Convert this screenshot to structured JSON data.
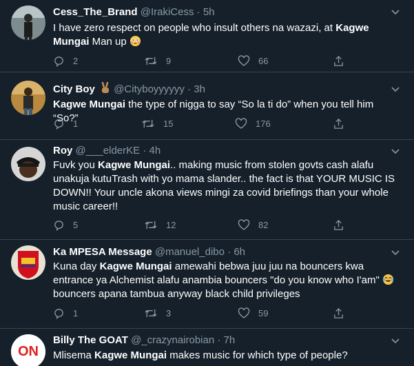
{
  "tweets": [
    {
      "name": "Cess_The_Brand",
      "handle": "@IrakiCess",
      "time": "5h",
      "body_before": "I have zero respect on people who insult others na wazazi, at ",
      "mention": "Kagwe Mungai",
      "body_after": " Man up",
      "emoji": "flushed-face",
      "replies": "2",
      "retweets": "9",
      "likes": "66"
    },
    {
      "name": "City Boy",
      "name_emoji": "victory-hand",
      "handle": "@Cityboyyyyyy",
      "time": "3h",
      "mention": "Kagwe Mungai",
      "body_after": " the type of nigga to say “So la ti do” when you tell him “So?”",
      "replies": "1",
      "retweets": "15",
      "likes": "176"
    },
    {
      "name": "Roy",
      "handle": "@___elderKE",
      "time": "4h",
      "body_before": "Fuvk you ",
      "mention": "Kagwe Mungai",
      "body_after": ".. making music from stolen govts cash alafu unakuja kutuTrash with yo mama slander.. the fact is that YOUR MUSIC IS DOWN!! Your uncle akona views mingi za covid briefings than your whole music career!!",
      "replies": "5",
      "retweets": "12",
      "likes": "82"
    },
    {
      "name": "Ka MPESA Message",
      "handle": "@manuel_dibo",
      "time": "6h",
      "body_before": "Kuna day ",
      "mention": "Kagwe Mungai",
      "body_after": " amewahi bebwa juu juu na bouncers kwa entrance ya Alchemist alafu anambia bouncers \"do you know who I'am\" ",
      "emoji": "tears-of-joy",
      "body_tail": "bouncers apana tambua anyway black child privileges",
      "replies": "1",
      "retweets": "3",
      "likes": "59"
    },
    {
      "name": "Billy The GOAT",
      "handle": "@_crazynairobian",
      "time": "7h",
      "body_before": "Mlisema ",
      "mention": "Kagwe Mungai",
      "body_after": " makes music for which type of people?",
      "avatar_text": "ON"
    }
  ],
  "separator": "·",
  "colors": {
    "background": "#15202b",
    "divider": "#38444d",
    "secondary_text": "#8899a6"
  }
}
